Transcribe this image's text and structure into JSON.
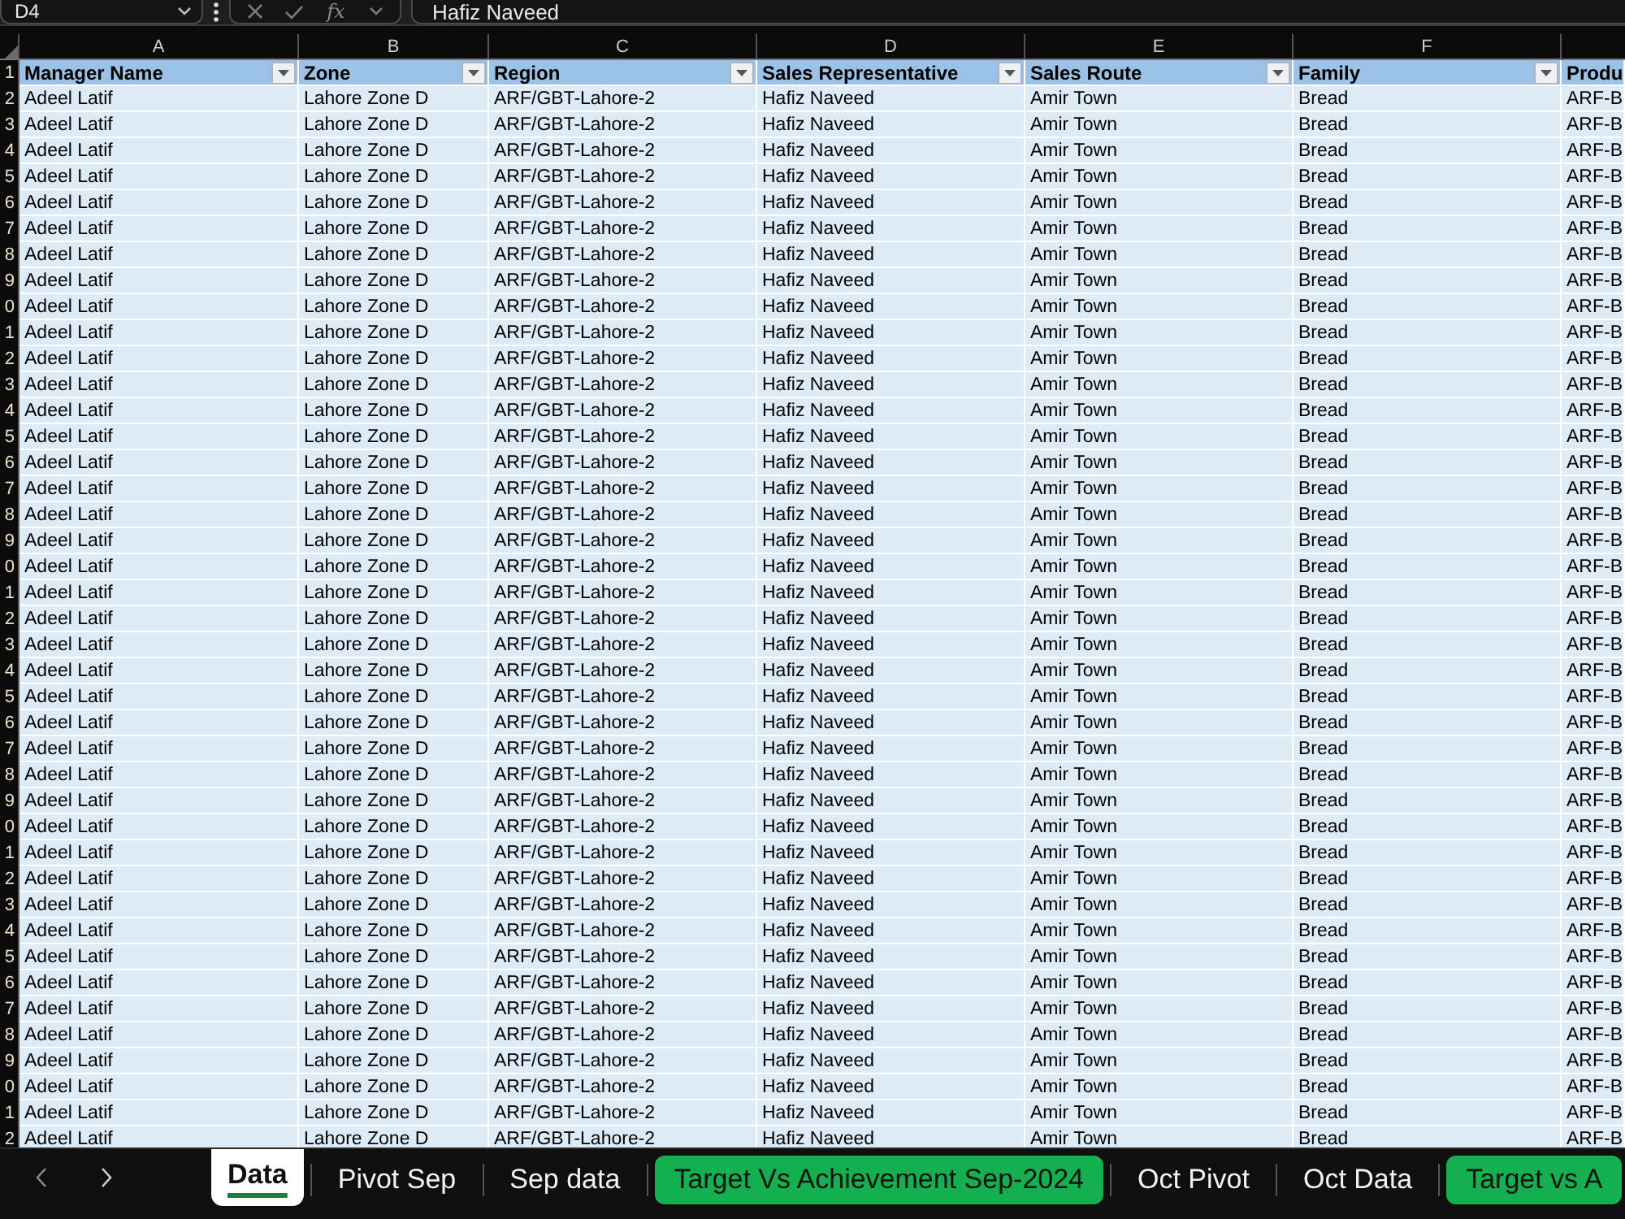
{
  "formula_bar": {
    "name_box": "D4",
    "function_button": "fx",
    "formula": "Hafiz Naveed"
  },
  "columns": [
    {
      "letter": "A",
      "header": "Manager Name"
    },
    {
      "letter": "B",
      "header": "Zone"
    },
    {
      "letter": "C",
      "header": "Region"
    },
    {
      "letter": "D",
      "header": "Sales Representative"
    },
    {
      "letter": "E",
      "header": "Sales Route"
    },
    {
      "letter": "F",
      "header": "Family"
    },
    {
      "header": "Produ"
    }
  ],
  "header_row_number": "1",
  "rows": [
    {
      "number": "2",
      "cells": [
        "Adeel Latif",
        "Lahore Zone D",
        "ARF/GBT-Lahore-2",
        "Hafiz Naveed",
        "Amir Town",
        "Bread",
        "ARF-B"
      ]
    },
    {
      "number": "3",
      "cells": [
        "Adeel Latif",
        "Lahore Zone D",
        "ARF/GBT-Lahore-2",
        "Hafiz Naveed",
        "Amir Town",
        "Bread",
        "ARF-B"
      ]
    },
    {
      "number": "4",
      "cells": [
        "Adeel Latif",
        "Lahore Zone D",
        "ARF/GBT-Lahore-2",
        "Hafiz Naveed",
        "Amir Town",
        "Bread",
        "ARF-B"
      ]
    },
    {
      "number": "5",
      "cells": [
        "Adeel Latif",
        "Lahore Zone D",
        "ARF/GBT-Lahore-2",
        "Hafiz Naveed",
        "Amir Town",
        "Bread",
        "ARF-B"
      ]
    },
    {
      "number": "6",
      "cells": [
        "Adeel Latif",
        "Lahore Zone D",
        "ARF/GBT-Lahore-2",
        "Hafiz Naveed",
        "Amir Town",
        "Bread",
        "ARF-B"
      ]
    },
    {
      "number": "7",
      "cells": [
        "Adeel Latif",
        "Lahore Zone D",
        "ARF/GBT-Lahore-2",
        "Hafiz Naveed",
        "Amir Town",
        "Bread",
        "ARF-B"
      ]
    },
    {
      "number": "8",
      "cells": [
        "Adeel Latif",
        "Lahore Zone D",
        "ARF/GBT-Lahore-2",
        "Hafiz Naveed",
        "Amir Town",
        "Bread",
        "ARF-B"
      ]
    },
    {
      "number": "9",
      "cells": [
        "Adeel Latif",
        "Lahore Zone D",
        "ARF/GBT-Lahore-2",
        "Hafiz Naveed",
        "Amir Town",
        "Bread",
        "ARF-B"
      ]
    },
    {
      "number": "0",
      "cells": [
        "Adeel Latif",
        "Lahore Zone D",
        "ARF/GBT-Lahore-2",
        "Hafiz Naveed",
        "Amir Town",
        "Bread",
        "ARF-B"
      ]
    },
    {
      "number": "1",
      "cells": [
        "Adeel Latif",
        "Lahore Zone D",
        "ARF/GBT-Lahore-2",
        "Hafiz Naveed",
        "Amir Town",
        "Bread",
        "ARF-B"
      ]
    },
    {
      "number": "2",
      "cells": [
        "Adeel Latif",
        "Lahore Zone D",
        "ARF/GBT-Lahore-2",
        "Hafiz Naveed",
        "Amir Town",
        "Bread",
        "ARF-B"
      ]
    },
    {
      "number": "3",
      "cells": [
        "Adeel Latif",
        "Lahore Zone D",
        "ARF/GBT-Lahore-2",
        "Hafiz Naveed",
        "Amir Town",
        "Bread",
        "ARF-B"
      ]
    },
    {
      "number": "4",
      "cells": [
        "Adeel Latif",
        "Lahore Zone D",
        "ARF/GBT-Lahore-2",
        "Hafiz Naveed",
        "Amir Town",
        "Bread",
        "ARF-B"
      ]
    },
    {
      "number": "5",
      "cells": [
        "Adeel Latif",
        "Lahore Zone D",
        "ARF/GBT-Lahore-2",
        "Hafiz Naveed",
        "Amir Town",
        "Bread",
        "ARF-B"
      ]
    },
    {
      "number": "6",
      "cells": [
        "Adeel Latif",
        "Lahore Zone D",
        "ARF/GBT-Lahore-2",
        "Hafiz Naveed",
        "Amir Town",
        "Bread",
        "ARF-B"
      ]
    },
    {
      "number": "7",
      "cells": [
        "Adeel Latif",
        "Lahore Zone D",
        "ARF/GBT-Lahore-2",
        "Hafiz Naveed",
        "Amir Town",
        "Bread",
        "ARF-B"
      ]
    },
    {
      "number": "8",
      "cells": [
        "Adeel Latif",
        "Lahore Zone D",
        "ARF/GBT-Lahore-2",
        "Hafiz Naveed",
        "Amir Town",
        "Bread",
        "ARF-B"
      ]
    },
    {
      "number": "9",
      "cells": [
        "Adeel Latif",
        "Lahore Zone D",
        "ARF/GBT-Lahore-2",
        "Hafiz Naveed",
        "Amir Town",
        "Bread",
        "ARF-B"
      ]
    },
    {
      "number": "0",
      "cells": [
        "Adeel Latif",
        "Lahore Zone D",
        "ARF/GBT-Lahore-2",
        "Hafiz Naveed",
        "Amir Town",
        "Bread",
        "ARF-B"
      ]
    },
    {
      "number": "1",
      "cells": [
        "Adeel Latif",
        "Lahore Zone D",
        "ARF/GBT-Lahore-2",
        "Hafiz Naveed",
        "Amir Town",
        "Bread",
        "ARF-B"
      ]
    },
    {
      "number": "2",
      "cells": [
        "Adeel Latif",
        "Lahore Zone D",
        "ARF/GBT-Lahore-2",
        "Hafiz Naveed",
        "Amir Town",
        "Bread",
        "ARF-B"
      ]
    },
    {
      "number": "3",
      "cells": [
        "Adeel Latif",
        "Lahore Zone D",
        "ARF/GBT-Lahore-2",
        "Hafiz Naveed",
        "Amir Town",
        "Bread",
        "ARF-B"
      ]
    },
    {
      "number": "4",
      "cells": [
        "Adeel Latif",
        "Lahore Zone D",
        "ARF/GBT-Lahore-2",
        "Hafiz Naveed",
        "Amir Town",
        "Bread",
        "ARF-B"
      ]
    },
    {
      "number": "5",
      "cells": [
        "Adeel Latif",
        "Lahore Zone D",
        "ARF/GBT-Lahore-2",
        "Hafiz Naveed",
        "Amir Town",
        "Bread",
        "ARF-B"
      ]
    },
    {
      "number": "6",
      "cells": [
        "Adeel Latif",
        "Lahore Zone D",
        "ARF/GBT-Lahore-2",
        "Hafiz Naveed",
        "Amir Town",
        "Bread",
        "ARF-B"
      ]
    },
    {
      "number": "7",
      "cells": [
        "Adeel Latif",
        "Lahore Zone D",
        "ARF/GBT-Lahore-2",
        "Hafiz Naveed",
        "Amir Town",
        "Bread",
        "ARF-B"
      ]
    },
    {
      "number": "8",
      "cells": [
        "Adeel Latif",
        "Lahore Zone D",
        "ARF/GBT-Lahore-2",
        "Hafiz Naveed",
        "Amir Town",
        "Bread",
        "ARF-B"
      ]
    },
    {
      "number": "9",
      "cells": [
        "Adeel Latif",
        "Lahore Zone D",
        "ARF/GBT-Lahore-2",
        "Hafiz Naveed",
        "Amir Town",
        "Bread",
        "ARF-B"
      ]
    },
    {
      "number": "0",
      "cells": [
        "Adeel Latif",
        "Lahore Zone D",
        "ARF/GBT-Lahore-2",
        "Hafiz Naveed",
        "Amir Town",
        "Bread",
        "ARF-B"
      ]
    },
    {
      "number": "1",
      "cells": [
        "Adeel Latif",
        "Lahore Zone D",
        "ARF/GBT-Lahore-2",
        "Hafiz Naveed",
        "Amir Town",
        "Bread",
        "ARF-B"
      ]
    },
    {
      "number": "2",
      "cells": [
        "Adeel Latif",
        "Lahore Zone D",
        "ARF/GBT-Lahore-2",
        "Hafiz Naveed",
        "Amir Town",
        "Bread",
        "ARF-B"
      ]
    },
    {
      "number": "3",
      "cells": [
        "Adeel Latif",
        "Lahore Zone D",
        "ARF/GBT-Lahore-2",
        "Hafiz Naveed",
        "Amir Town",
        "Bread",
        "ARF-B"
      ]
    },
    {
      "number": "4",
      "cells": [
        "Adeel Latif",
        "Lahore Zone D",
        "ARF/GBT-Lahore-2",
        "Hafiz Naveed",
        "Amir Town",
        "Bread",
        "ARF-B"
      ]
    },
    {
      "number": "5",
      "cells": [
        "Adeel Latif",
        "Lahore Zone D",
        "ARF/GBT-Lahore-2",
        "Hafiz Naveed",
        "Amir Town",
        "Bread",
        "ARF-B"
      ]
    },
    {
      "number": "6",
      "cells": [
        "Adeel Latif",
        "Lahore Zone D",
        "ARF/GBT-Lahore-2",
        "Hafiz Naveed",
        "Amir Town",
        "Bread",
        "ARF-B"
      ]
    },
    {
      "number": "7",
      "cells": [
        "Adeel Latif",
        "Lahore Zone D",
        "ARF/GBT-Lahore-2",
        "Hafiz Naveed",
        "Amir Town",
        "Bread",
        "ARF-B"
      ]
    },
    {
      "number": "8",
      "cells": [
        "Adeel Latif",
        "Lahore Zone D",
        "ARF/GBT-Lahore-2",
        "Hafiz Naveed",
        "Amir Town",
        "Bread",
        "ARF-B"
      ]
    },
    {
      "number": "9",
      "cells": [
        "Adeel Latif",
        "Lahore Zone D",
        "ARF/GBT-Lahore-2",
        "Hafiz Naveed",
        "Amir Town",
        "Bread",
        "ARF-B"
      ]
    },
    {
      "number": "0",
      "cells": [
        "Adeel Latif",
        "Lahore Zone D",
        "ARF/GBT-Lahore-2",
        "Hafiz Naveed",
        "Amir Town",
        "Bread",
        "ARF-B"
      ]
    },
    {
      "number": "1",
      "cells": [
        "Adeel Latif",
        "Lahore Zone D",
        "ARF/GBT-Lahore-2",
        "Hafiz Naveed",
        "Amir Town",
        "Bread",
        "ARF-B"
      ]
    },
    {
      "number": "2",
      "cells": [
        "Adeel Latif",
        "Lahore Zone D",
        "ARF/GBT-Lahore-2",
        "Hafiz Naveed",
        "Amir Town",
        "Bread",
        "ARF-B"
      ]
    }
  ],
  "sheet_tabs": [
    {
      "label": "Data",
      "selected": true
    },
    {
      "label": "Pivot Sep",
      "selected": false
    },
    {
      "label": "Sep data",
      "selected": false
    },
    {
      "label": "Target Vs Achievement Sep-2024",
      "selected": false,
      "color": "#14b050"
    },
    {
      "label": "Oct Pivot",
      "selected": false
    },
    {
      "label": "Oct Data",
      "selected": false
    },
    {
      "label": "Target vs A",
      "selected": false,
      "color": "#14b050"
    }
  ]
}
